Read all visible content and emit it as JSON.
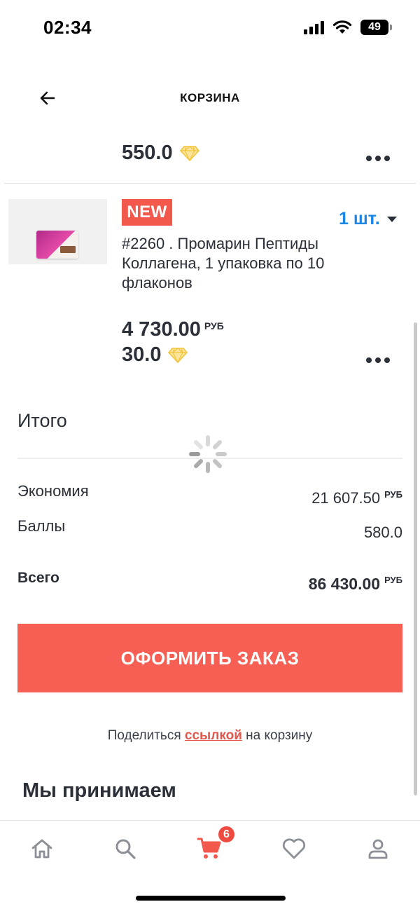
{
  "status_bar": {
    "time": "02:34",
    "battery": "49"
  },
  "header": {
    "title": "КОРЗИНА"
  },
  "cart_items": [
    {
      "points": "550.0"
    },
    {
      "badge": "NEW",
      "quantity": "1 шт.",
      "title": "#2260 . Промарин Пептиды Коллагена, 1 упаковка по 10 флаконов",
      "price": "4 730.00",
      "currency": "РУБ",
      "points": "30.0"
    }
  ],
  "totals": {
    "title": "Итого",
    "savings_label": "Экономия",
    "savings_value": "21 607.50",
    "savings_currency": "РУБ",
    "points_label": "Баллы",
    "points_value": "580.0",
    "total_label": "Всего",
    "total_value": "86 430.00",
    "total_currency": "РУБ"
  },
  "checkout_label": "ОФОРМИТЬ ЗАКАЗ",
  "share": {
    "prefix": "Поделиться",
    "link": "ссылкой",
    "suffix": "на корзину"
  },
  "accept_title": "Мы принимаем",
  "bottom_nav": {
    "cart_badge": "6"
  },
  "colors": {
    "accent": "#f75f55",
    "link_blue": "#1c86e6",
    "text_dark": "#2b2f38",
    "diamond_gold": "#f2d04a"
  }
}
